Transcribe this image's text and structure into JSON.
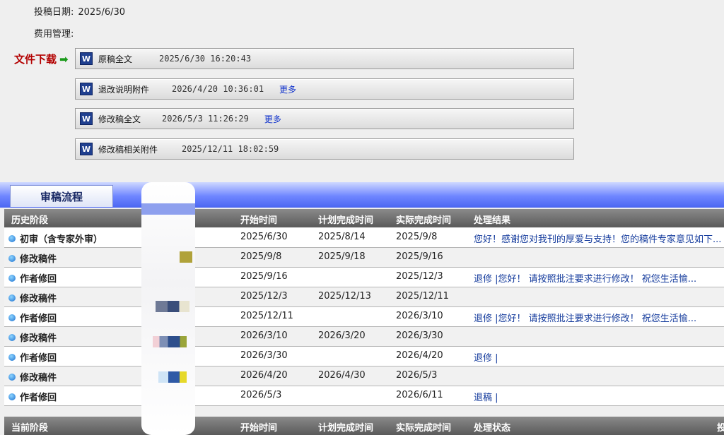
{
  "submission": {
    "date_label": "投稿日期:",
    "date_value": "2025/6/30",
    "fee_label": "费用管理:"
  },
  "download": {
    "label": "文件下载",
    "files": [
      {
        "name": "原稿全文",
        "time": "2025/6/30 16:20:43",
        "more": ""
      },
      {
        "name": "退改说明附件",
        "time": "2026/4/20 10:36:01",
        "more": "更多"
      },
      {
        "name": "修改稿全文",
        "time": "2026/5/3 11:26:29",
        "more": "更多"
      },
      {
        "name": "修改稿相关附件",
        "time": "2025/12/11 18:02:59",
        "more": ""
      }
    ]
  },
  "process": {
    "tab_label": "审稿流程",
    "headers": {
      "stage": "历史阶段",
      "start": "开始时间",
      "plan": "计划完成时间",
      "actual": "实际完成时间",
      "result": "处理结果"
    },
    "rows": [
      {
        "stage": "初审（含专家外审）",
        "start": "2025/6/30",
        "plan": "2025/8/14",
        "actual": "2025/9/8",
        "result": "您好！感谢您对我刊的厚爱与支持！您的稿件专家意见如下..."
      },
      {
        "stage": "修改稿件",
        "start": "2025/9/8",
        "plan": "2025/9/18",
        "actual": "2025/9/16",
        "result": ""
      },
      {
        "stage": "作者修回",
        "start": "2025/9/16",
        "plan": "",
        "actual": "2025/12/3",
        "result": "退修 |您好！ 请按照批注要求进行修改！ 祝您生活愉..."
      },
      {
        "stage": "修改稿件",
        "start": "2025/12/3",
        "plan": "2025/12/13",
        "actual": "2025/12/11",
        "result": ""
      },
      {
        "stage": "作者修回",
        "start": "2025/12/11",
        "plan": "",
        "actual": "2026/3/10",
        "result": "退修 |您好！ 请按照批注要求进行修改！ 祝您生活愉..."
      },
      {
        "stage": "修改稿件",
        "start": "2026/3/10",
        "plan": "2026/3/20",
        "actual": "2026/3/30",
        "result": ""
      },
      {
        "stage": "作者修回",
        "start": "2026/3/30",
        "plan": "",
        "actual": "2026/4/20",
        "result": "退修 |"
      },
      {
        "stage": "修改稿件",
        "start": "2026/4/20",
        "plan": "2026/4/30",
        "actual": "2026/5/3",
        "result": ""
      },
      {
        "stage": "作者修回",
        "start": "2026/5/3",
        "plan": "",
        "actual": "2026/6/11",
        "result": "退稿 |"
      }
    ],
    "footer_headers": {
      "stage": "当前阶段",
      "start": "开始时间",
      "plan": "计划完成时间",
      "actual": "实际完成时间",
      "result": "处理状态",
      "extra": "投"
    }
  },
  "icons": {
    "download_arrow": "green-arrow-icon",
    "file": "document-icon",
    "row_bullet": "blue-dot-icon"
  },
  "colors": {
    "download_label": "#b30000",
    "band": "#4b66f2",
    "header": "#6a6a6a",
    "link": "#1133cc"
  }
}
